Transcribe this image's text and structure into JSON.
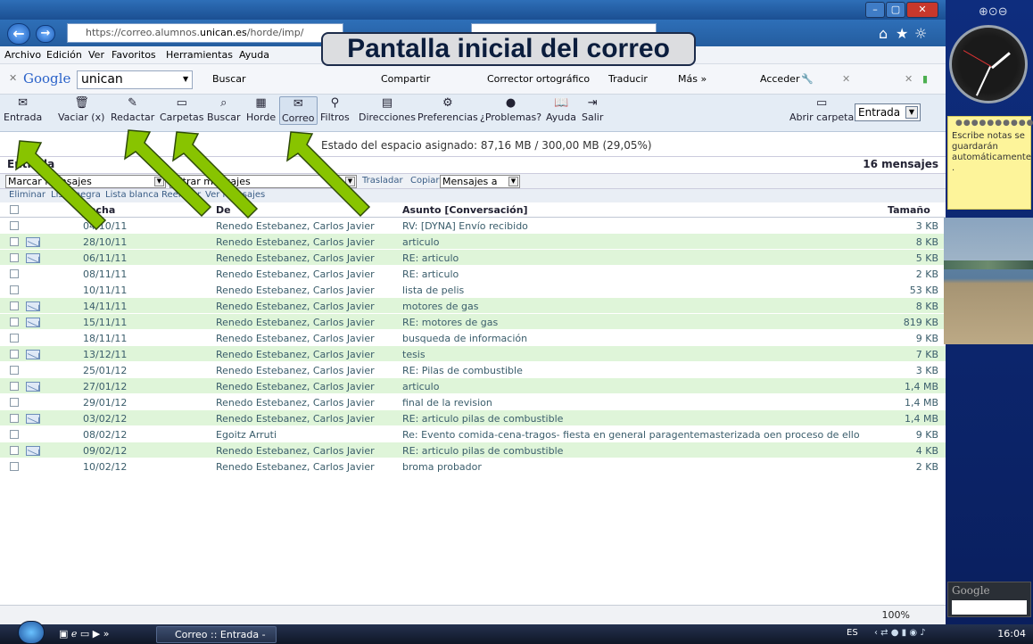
{
  "browser": {
    "url_prefix": "https://correo.alumnos.",
    "url_domain": "unican.es",
    "url_suffix": "/horde/imp/",
    "menu": [
      "Archivo",
      "Edición",
      "Ver",
      "Favoritos",
      "Herramientas",
      "Ayuda"
    ],
    "google_bar": {
      "logo": "Google",
      "query": "unican",
      "buscar": "Buscar",
      "compartir": "Compartir",
      "corrector": "Corrector ortográfico",
      "traducir": "Traducir",
      "mas": "Más »",
      "acceder": "Acceder"
    },
    "zoom": "100%"
  },
  "overlay_title": "Pantalla inicial del correo",
  "horde_toolbar": {
    "items": [
      "Entrada",
      "Vaciar (x)",
      "Redactar",
      "Carpetas",
      "Buscar",
      "Horde",
      "Correo",
      "Filtros",
      "Direcciones",
      "Preferencias",
      "¿Problemas?",
      "Ayuda",
      "Salir"
    ],
    "open_folder": "Abrir carpeta",
    "folder_value": "Entrada"
  },
  "quota": "Estado del espacio asignado: 87,16 MB / 300,00 MB (29,05%)",
  "mailbox": {
    "title": "Entrada",
    "count": "16 mensajes",
    "mark_select": "Marcar mensajes",
    "filter_select": "Filtrar mensajes",
    "move_label": "Trasladar",
    "copy_label": "Copiar",
    "target_select": "Mensajes a",
    "actions": [
      "Eliminar",
      "Lista negra",
      "Lista blanca",
      "Reenviar",
      "Ver mensajes"
    ],
    "headers": {
      "date": "Fecha",
      "from": "De",
      "subject": "Asunto [Conversación]",
      "size": "Tamaño"
    },
    "messages": [
      {
        "date": "04/10/11",
        "from": "Renedo Estebanez, Carlos Javier",
        "subject": "RV: [DYNA] Envío recibido",
        "size": "3 KB",
        "hl": false,
        "env": false
      },
      {
        "date": "28/10/11",
        "from": "Renedo Estebanez, Carlos Javier",
        "subject": "articulo",
        "size": "8 KB",
        "hl": true,
        "env": true
      },
      {
        "date": "06/11/11",
        "from": "Renedo Estebanez, Carlos Javier",
        "subject": "RE: articulo",
        "size": "5 KB",
        "hl": true,
        "env": true
      },
      {
        "date": "08/11/11",
        "from": "Renedo Estebanez, Carlos Javier",
        "subject": "RE: articulo",
        "size": "2 KB",
        "hl": false,
        "env": false
      },
      {
        "date": "10/11/11",
        "from": "Renedo Estebanez, Carlos Javier",
        "subject": "lista de pelis",
        "size": "53 KB",
        "hl": false,
        "env": false
      },
      {
        "date": "14/11/11",
        "from": "Renedo Estebanez, Carlos Javier",
        "subject": "motores de gas",
        "size": "8 KB",
        "hl": true,
        "env": true
      },
      {
        "date": "15/11/11",
        "from": "Renedo Estebanez, Carlos Javier",
        "subject": "RE: motores de gas",
        "size": "819 KB",
        "hl": true,
        "env": true
      },
      {
        "date": "18/11/11",
        "from": "Renedo Estebanez, Carlos Javier",
        "subject": "busqueda de información",
        "size": "9 KB",
        "hl": false,
        "env": false
      },
      {
        "date": "13/12/11",
        "from": "Renedo Estebanez, Carlos Javier",
        "subject": "tesis",
        "size": "7 KB",
        "hl": true,
        "env": true
      },
      {
        "date": "25/01/12",
        "from": "Renedo Estebanez, Carlos Javier",
        "subject": "RE: Pilas de combustible",
        "size": "3 KB",
        "hl": false,
        "env": false
      },
      {
        "date": "27/01/12",
        "from": "Renedo Estebanez, Carlos Javier",
        "subject": "articulo",
        "size": "1,4 MB",
        "hl": true,
        "env": true
      },
      {
        "date": "29/01/12",
        "from": "Renedo Estebanez, Carlos Javier",
        "subject": "final de la revision",
        "size": "1,4 MB",
        "hl": false,
        "env": false
      },
      {
        "date": "03/02/12",
        "from": "Renedo Estebanez, Carlos Javier",
        "subject": "RE: articulo pilas de combustible",
        "size": "1,4 MB",
        "hl": true,
        "env": true
      },
      {
        "date": "08/02/12",
        "from": "Egoitz Arruti",
        "subject": "Re: Evento comida-cena-tragos- fiesta en general paragentemasterizada oen proceso de ello",
        "size": "9 KB",
        "hl": false,
        "env": false
      },
      {
        "date": "09/02/12",
        "from": "Renedo Estebanez, Carlos Javier",
        "subject": "RE: articulo pilas de combustible",
        "size": "4 KB",
        "hl": true,
        "env": true
      },
      {
        "date": "10/02/12",
        "from": "Renedo Estebanez, Carlos Javier",
        "subject": "broma probador",
        "size": "2 KB",
        "hl": false,
        "env": false
      }
    ]
  },
  "taskbar": {
    "task": "Correo :: Entrada - ...",
    "lang": "ES",
    "time": "16:04"
  },
  "gadgets": {
    "note_text": "Escribe notas se guardarán automáticamente .",
    "google": "Google"
  },
  "colors": {
    "arrow": "#88c400",
    "highlight_row": "#dff5d9",
    "overlay_bg": "#dcdde0"
  }
}
